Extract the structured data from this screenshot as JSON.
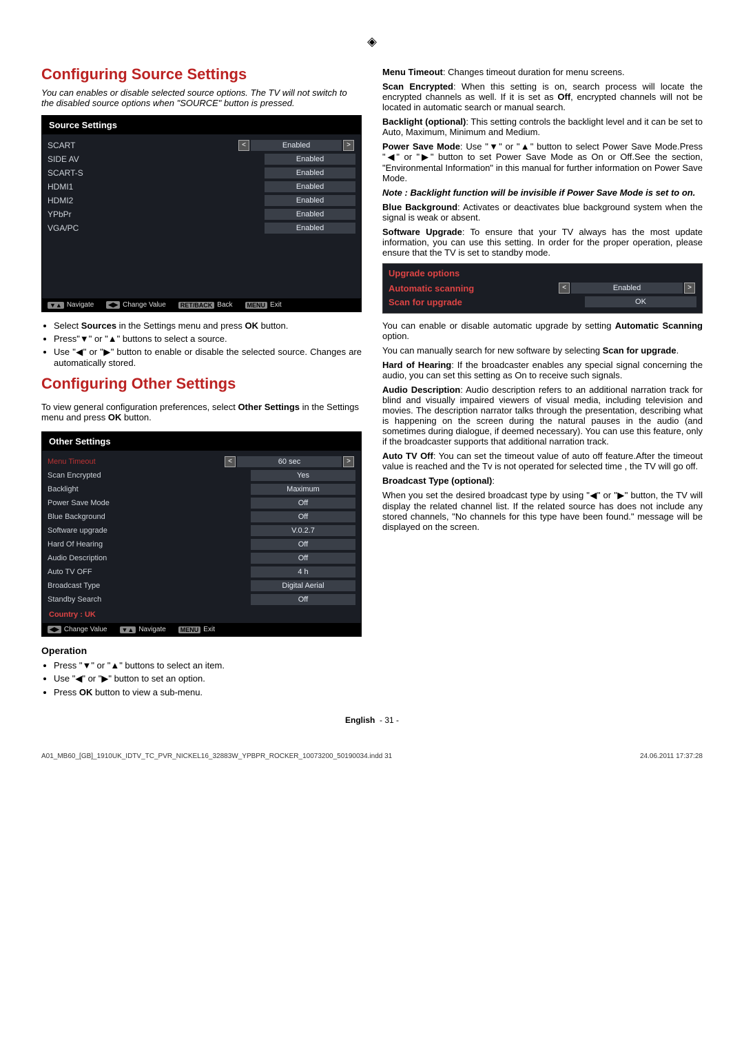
{
  "left": {
    "heading1": "Configuring Source Settings",
    "intro1": "You can enables or disable selected source options. The TV will not switch to the disabled source options when \"SOURCE\" button is pressed.",
    "source_menu": {
      "title": "Source Settings",
      "items": [
        {
          "name": "SCART",
          "value": "Enabled",
          "selected": true
        },
        {
          "name": "SIDE AV",
          "value": "Enabled"
        },
        {
          "name": "SCART-S",
          "value": "Enabled"
        },
        {
          "name": "HDMI1",
          "value": "Enabled"
        },
        {
          "name": "HDMI2",
          "value": "Enabled"
        },
        {
          "name": "YPbPr",
          "value": "Enabled"
        },
        {
          "name": "VGA/PC",
          "value": "Enabled"
        }
      ],
      "footer": {
        "navigate": "Navigate",
        "change": "Change Value",
        "back_key": "RET/BACK",
        "back": "Back",
        "menu_key": "MENU",
        "exit": "Exit"
      }
    },
    "bullets1": [
      "Select <b>Sources</b> in the Settings menu and press <b>OK</b> button.",
      "Press\"▼\" or \"▲\" buttons to select a source.",
      "Use \"◀\" or \"▶\" button to enable or disable the selected source. Changes are automatically stored."
    ],
    "heading2": "Configuring Other Settings",
    "intro2": "To view general configuration preferences, select <b>Other Settings</b> in the Settings menu and press <b>OK</b> button.",
    "other_menu": {
      "title": "Other Settings",
      "items": [
        {
          "name": "Menu Timeout",
          "value": "60 sec",
          "selected": true,
          "color": "#b33"
        },
        {
          "name": "Scan Encrypted",
          "value": "Yes"
        },
        {
          "name": "Backlight",
          "value": "Maximum"
        },
        {
          "name": "Power Save Mode",
          "value": "Off"
        },
        {
          "name": "Blue Background",
          "value": "Off"
        },
        {
          "name": "Software upgrade",
          "value": "V.0.2.7"
        },
        {
          "name": "Hard Of Hearing",
          "value": "Off"
        },
        {
          "name": "Audio Description",
          "value": "Off"
        },
        {
          "name": "Auto TV OFF",
          "value": "4 h"
        },
        {
          "name": "Broadcast Type",
          "value": "Digital Aerial"
        },
        {
          "name": "Standby Search",
          "value": "Off"
        }
      ],
      "country": "Country : UK",
      "footer": {
        "change": "Change Value",
        "navigate": "Navigate",
        "menu_key": "MENU",
        "exit": "Exit"
      }
    },
    "operation_title": "Operation",
    "bullets2": [
      "Press \"▼\" or \"▲\" buttons to select an item.",
      "Use \"◀\" or \"▶\" button to set an option.",
      "Press <b>OK</b> button to view a sub-menu."
    ]
  },
  "right": {
    "paras": [
      "<b>Menu Timeout</b>: Changes timeout duration for menu screens.",
      "<b>Scan Encrypted</b>: When this setting is on, search process will locate the encrypted channels as well. If it is set as <b>Off</b>, encrypted channels will not be located in automatic search or manual search.",
      "<b>Backlight (optional)</b>: This setting controls the backlight level and it can be set to Auto, Maximum, Minimum and Medium.",
      "<b>Power Save Mode</b>: Use \"▼\" or \"▲\" button to select Power Save Mode.Press \"◀\" or \"▶\" button to set Power Save Mode as On or Off.See the section, \"Environmental Information\" in this manual for further information on Power Save Mode."
    ],
    "note": "Note : Backlight function will be invisible if Power Save Mode is set to on.",
    "paras2": [
      "<b>Blue Background</b>: Activates or deactivates blue background system when the signal is weak or absent.",
      "<b>Software Upgrade</b>: To ensure that your TV always has the most update information, you can use this setting. In order for the proper operation, please ensure that the TV is set to standby mode."
    ],
    "upgrade_menu": {
      "title": "Upgrade options",
      "items": [
        {
          "name": "Automatic scanning",
          "value": "Enabled",
          "selected": true
        },
        {
          "name": "Scan for upgrade",
          "value": "OK"
        }
      ]
    },
    "paras3": [
      "You can enable or disable automatic upgrade by setting <b>Automatic Scanning</b> option.",
      "You can manually search for new software by selecting <b>Scan for upgrade</b>.",
      "<b>Hard of Hearing</b>: If the broadcaster enables any special signal concerning the audio, you can set this setting as On to receive such signals.",
      "<b>Audio Description</b>: Audio description refers to an additional narration track for blind and visually impaired viewers of visual media, including television and movies. The description narrator talks through the presentation, describing what is happening on the screen during the natural pauses in the audio (and sometimes during dialogue, if deemed necessary). You can use this feature, only if the broadcaster supports that additional narration track.",
      "<b>Auto TV Off</b>: You can set the timeout value of auto off feature.After the timeout value is reached and the Tv is not operated for selected time , the TV will go off.",
      "<b>Broadcast Type (optional)</b>:",
      "When you set the desired broadcast type by using \"◀\" or \"▶\" button, the TV will display the related channel list. If the related source has does not include any stored channels, \"No channels for this type have been found.\" message will be displayed on the screen."
    ]
  },
  "page_footer": {
    "lang": "English",
    "page": "- 31 -"
  },
  "file_footer": {
    "name": "A01_MB60_[GB]_1910UK_IDTV_TC_PVR_NICKEL16_32883W_YPBPR_ROCKER_10073200_50190034.indd   31",
    "date": "24.06.2011   17:37:28"
  }
}
